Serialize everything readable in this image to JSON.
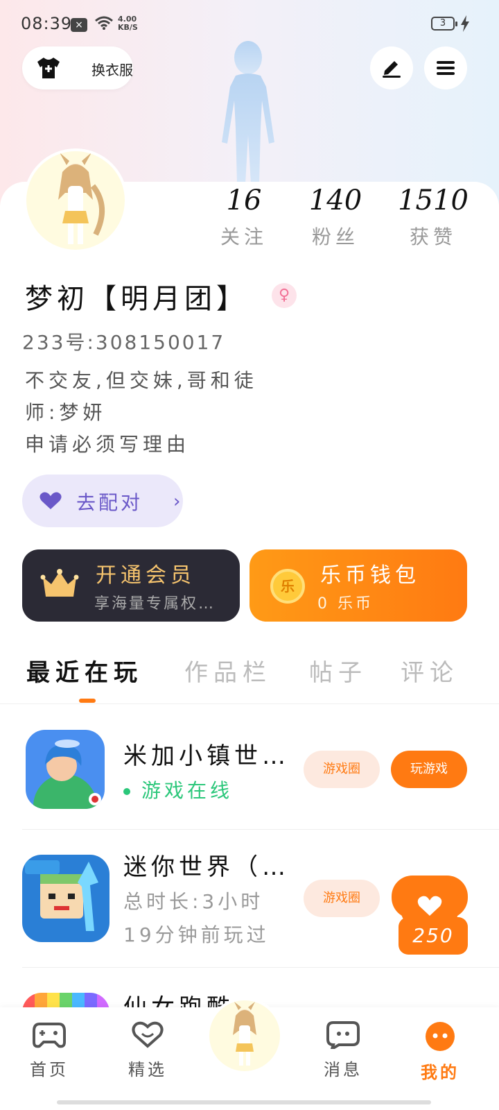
{
  "status_bar": {
    "time": "08:39",
    "x_label": "×",
    "speed_value": "4.00",
    "speed_unit": "KB/S",
    "battery": "3"
  },
  "top": {
    "dress_label": "换衣服"
  },
  "stats": [
    {
      "num": "16",
      "label": "关注"
    },
    {
      "num": "140",
      "label": "粉丝"
    },
    {
      "num": "1510",
      "label": "获赞"
    }
  ],
  "profile": {
    "name": "梦初【明月团】",
    "gender_symbol": "♀",
    "id_line": "233号:308150017",
    "bio_lines": [
      "不交友,但交妹,哥和徒",
      "师:梦妍",
      "申请必须写理由"
    ],
    "pair_label": "去配对",
    "pair_chevron": "›"
  },
  "cards": {
    "vip_title": "开通会员",
    "vip_sub": "享海量专属权…",
    "wallet_icon_text": "乐",
    "wallet_title": "乐币钱包",
    "wallet_sub": "0 乐币"
  },
  "tabs": [
    "最近在玩",
    "作品栏",
    "帖子",
    "评论"
  ],
  "games": [
    {
      "name": "米加小镇世…",
      "sub": "游戏在线",
      "circle_label": "游戏圈",
      "play_label": "玩游戏"
    },
    {
      "name": "迷你世界（…",
      "sub1": "总时长:3小时",
      "sub2": "19分钟前玩过",
      "circle_label": "游戏圈",
      "likes": "250"
    },
    {
      "name": "仙女跑酷…"
    }
  ],
  "nav": [
    "首页",
    "精选",
    "消息",
    "我的"
  ],
  "colors": {
    "accent": "#ff7a12",
    "pair_purple": "#6a58c8",
    "online_green": "#2bc77a",
    "vip_gold": "#f6c46e"
  }
}
